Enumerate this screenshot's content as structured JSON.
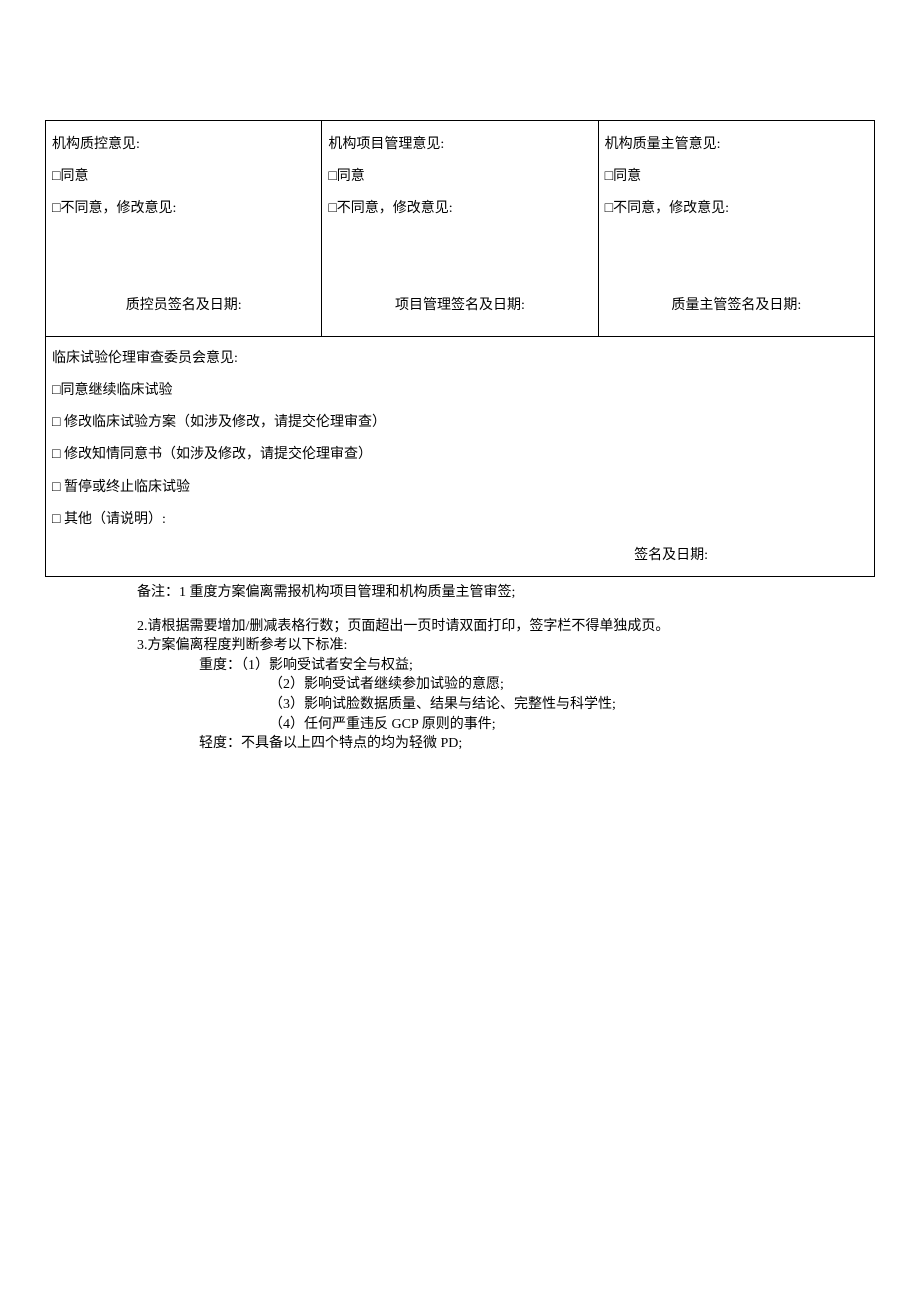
{
  "checkbox": "□",
  "top": {
    "col1": {
      "title": "机构质控意见:",
      "opt1": "同意",
      "opt2": "不同意，修改意见:",
      "sig": "质控员签名及日期:"
    },
    "col2": {
      "title": "机构项目管理意见:",
      "opt1": "同意",
      "opt2": "不同意，修改意见:",
      "sig": "项目管理签名及日期:"
    },
    "col3": {
      "title": "机构质量主管意见:",
      "opt1": "同意",
      "opt2": "不同意，修改意见:",
      "sig": "质量主管签名及日期:"
    }
  },
  "ethics": {
    "title": "临床试验伦理审查委员会意见:",
    "opt1": "同意继续临床试验",
    "opt2": " 修改临床试验方案（如涉及修改，请提交伦理审查）",
    "opt3": " 修改知情同意书（如涉及修改，请提交伦理审查）",
    "opt4": " 暂停或终止临床试验",
    "opt5": " 其他（请说明）:",
    "sig": "签名及日期:"
  },
  "notes": {
    "n1": "备注：1 重度方案偏离需报机构项目管理和机构质量主管审签;",
    "n2": "2.请根据需要增加/删减表格行数；页面超出一页时请双面打印，签字栏不得单独成页。",
    "n3": "3.方案偏离程度判断参考以下标准:",
    "n4": "重度：（1）影响受试者安全与权益;",
    "n5": "（2）影响受试者继续参加试验的意愿;",
    "n6": "（3）影响试脸数据质量、结果与结论、完整性与科学性;",
    "n7": "（4）任何严重违反 GCP 原则的事件;",
    "n8": "轻度：不具备以上四个特点的均为轻微 PD;"
  }
}
